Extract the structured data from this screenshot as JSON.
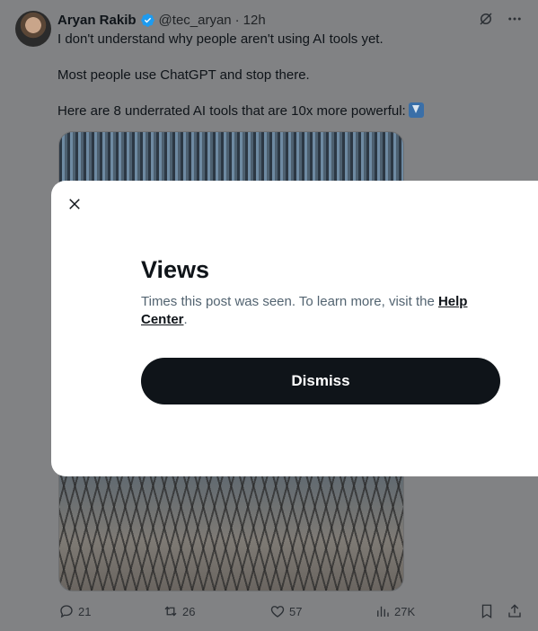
{
  "tweet": {
    "author_name": "Aryan Rakib",
    "handle": "@tec_aryan",
    "separator": "·",
    "time": "12h",
    "line1": "I don't understand why people aren't using AI tools yet.",
    "line2": "Most people use ChatGPT and stop there.",
    "line3": "Here are 8 underrated AI tools that are 10x more powerful:",
    "emoji": "down-arrow-emoji",
    "icons": {
      "grok": "grok-icon",
      "more": "more-icon"
    }
  },
  "actions": {
    "replies": "21",
    "reposts": "26",
    "likes": "57",
    "views": "27K"
  },
  "modal": {
    "title": "Views",
    "body_prefix": "Times this post was seen. To learn more, visit the ",
    "link_text": "Help Center",
    "body_suffix": ".",
    "dismiss_label": "Dismiss"
  },
  "colors": {
    "overlay_background": "#818284",
    "verified_blue": "#1d9bf0",
    "button_dark": "#0f1419"
  }
}
